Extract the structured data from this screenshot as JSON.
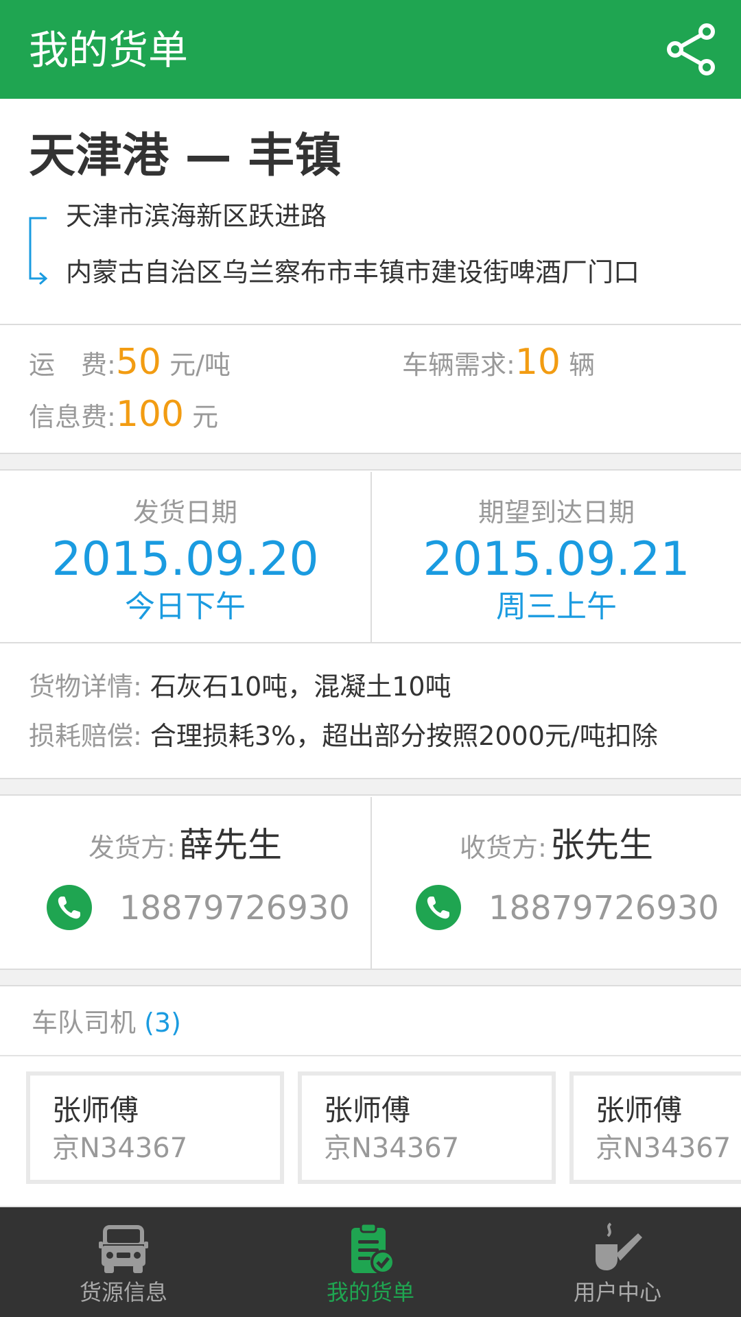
{
  "appbar": {
    "title": "我的货单",
    "share_icon": "share-icon"
  },
  "route": {
    "heading": "天津港 — 丰镇",
    "from": "天津市滨海新区跃进路",
    "to": "内蒙古自治区乌兰察布市丰镇市建设街啤酒厂门口"
  },
  "fees": {
    "freight_label": "运　费:",
    "freight_value": "50",
    "freight_unit": "元/吨",
    "vehicle_label": "车辆需求:",
    "vehicle_value": "10",
    "vehicle_unit": "辆",
    "info_label": "信息费:",
    "info_value": "100",
    "info_unit": "元"
  },
  "dates": {
    "ship": {
      "label": "发货日期",
      "date": "2015.09.20",
      "time": "今日下午"
    },
    "arrive": {
      "label": "期望到达日期",
      "date": "2015.09.21",
      "time": "周三上午"
    }
  },
  "goods": {
    "detail_label": "货物详情:",
    "detail_value": "石灰石10吨，混凝土10吨",
    "loss_label": "损耗赔偿:",
    "loss_value": "合理损耗3%，超出部分按照2000元/吨扣除"
  },
  "contacts": {
    "shipper": {
      "label": "发货方:",
      "name": "薛先生",
      "phone": "18879726930"
    },
    "receiver": {
      "label": "收货方:",
      "name": "张先生",
      "phone": "18879726930"
    }
  },
  "fleet": {
    "label": "车队司机",
    "count": "(3)"
  },
  "drivers": [
    {
      "name": "张师傅",
      "plate": "京N34367"
    },
    {
      "name": "张师傅",
      "plate": "京N34367"
    },
    {
      "name": "张师傅",
      "plate": "京N34367"
    }
  ],
  "tabs": [
    {
      "label": "货源信息",
      "icon": "truck-icon"
    },
    {
      "label": "我的货单",
      "icon": "clipboard-check-icon"
    },
    {
      "label": "用户中心",
      "icon": "pipe-icon"
    }
  ],
  "colors": {
    "brand": "#1fa551",
    "accent_blue": "#1a9be0",
    "accent_orange": "#f29c12",
    "tabbar": "#333333"
  }
}
